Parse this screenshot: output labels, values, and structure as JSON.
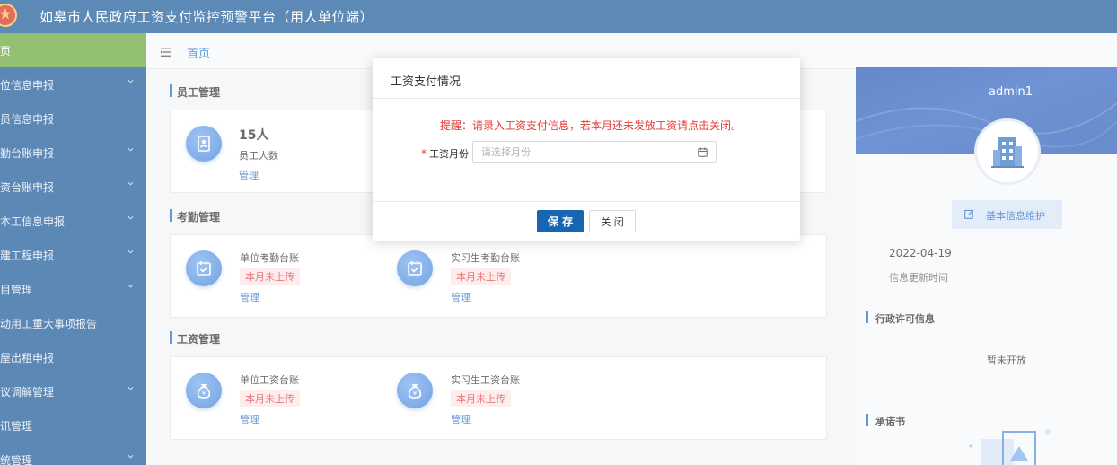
{
  "header": {
    "title": "如皋市人民政府工资支付监控预警平台（用人单位端）",
    "emblem_icon": "national-emblem-icon"
  },
  "sidebar": {
    "items": [
      {
        "label": "首页",
        "active": true,
        "has_children": false
      },
      {
        "label": "单位信息申报",
        "active": false,
        "has_children": true
      },
      {
        "label": "人员信息申报",
        "active": false,
        "has_children": false
      },
      {
        "label": "考勤台账申报",
        "active": false,
        "has_children": true
      },
      {
        "label": "工资台账申报",
        "active": false,
        "has_children": true
      },
      {
        "label": "基本工信息申报",
        "active": false,
        "has_children": true
      },
      {
        "label": "在建工程申报",
        "active": false,
        "has_children": true
      },
      {
        "label": "项目管理",
        "active": false,
        "has_children": true
      },
      {
        "label": "劳动用工重大事项报告",
        "active": false,
        "has_children": false
      },
      {
        "label": "房屋出租申报",
        "active": false,
        "has_children": false
      },
      {
        "label": "争议调解管理",
        "active": false,
        "has_children": true
      },
      {
        "label": "通讯管理",
        "active": false,
        "has_children": false
      },
      {
        "label": "系统管理",
        "active": false,
        "has_children": true
      }
    ]
  },
  "breadcrumb": {
    "home": "首页"
  },
  "sections": {
    "employee": {
      "title": "员工管理",
      "count": "15人",
      "count_label": "员工人数",
      "manage": "管理"
    },
    "attendance": {
      "title": "考勤管理",
      "cards": [
        {
          "name": "单位考勤台账",
          "status": "本月未上传",
          "manage": "管理"
        },
        {
          "name": "实习生考勤台账",
          "status": "本月未上传",
          "manage": "管理"
        }
      ]
    },
    "salary": {
      "title": "工资管理",
      "cards": [
        {
          "name": "单位工资台账",
          "status": "本月未上传",
          "manage": "管理"
        },
        {
          "name": "实习生工资台账",
          "status": "本月未上传",
          "manage": "管理"
        }
      ]
    }
  },
  "profile": {
    "username": "admin1",
    "basic_info_button": "基本信息维护",
    "update_date": "2022-04-19",
    "update_date_label": "信息更新时间",
    "license_title": "行政许可信息",
    "license_empty": "暂未开放",
    "promise_title": "承诺书"
  },
  "modal": {
    "title": "工资支付情况",
    "warning": "提醒：请录入工资支付信息，若本月还未发放工资请点击关闭。",
    "field_required_mark": "*",
    "field_label": "工资月份",
    "field_placeholder": "请选择月份",
    "field_value": "",
    "save_label": "保 存",
    "close_label": "关 闭"
  },
  "colors": {
    "header_bg": "#1e5c99",
    "sidebar_bg": "#1d5a97",
    "active_item": "#6aa83d",
    "primary": "#1766b1",
    "warning": "#e23b35"
  }
}
